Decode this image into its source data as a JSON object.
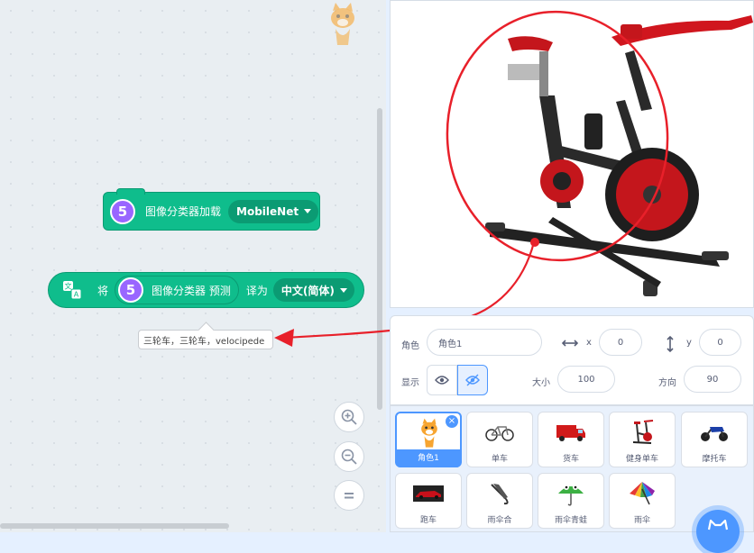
{
  "blocks": {
    "load": {
      "number": "5",
      "label": "图像分类器加载",
      "model": "MobileNet"
    },
    "translate": {
      "label_prefix": "将",
      "number": "5",
      "inner_label": "图像分类器 预测",
      "label_mid": "译为",
      "language": "中文(简体)"
    },
    "result": "三轮车，三轮车，velocipede"
  },
  "sprite_info": {
    "sprite_label": "角色",
    "sprite_name": "角色1",
    "x_label": "x",
    "x_value": "0",
    "y_label": "y",
    "y_value": "0",
    "show_label": "显示",
    "size_label": "大小",
    "size_value": "100",
    "direction_label": "方向",
    "direction_value": "90"
  },
  "sprites": [
    {
      "name": "角色1",
      "icon": "scratch-cat-icon"
    },
    {
      "name": "单车",
      "icon": "bicycle-icon"
    },
    {
      "name": "货车",
      "icon": "truck-icon"
    },
    {
      "name": "健身单车",
      "icon": "exercise-bike-icon"
    },
    {
      "name": "摩托车",
      "icon": "motorcycle-icon"
    },
    {
      "name": "跑车",
      "icon": "sports-car-icon"
    },
    {
      "name": "雨伞合",
      "icon": "closed-umbrella-icon"
    },
    {
      "name": "雨伞青蛙",
      "icon": "frog-umbrella-icon"
    },
    {
      "name": "雨伞",
      "icon": "umbrella-icon"
    }
  ],
  "colors": {
    "extension_green": "#0fbd8c",
    "number_purple": "#9966ff",
    "accent_blue": "#4d97ff",
    "annotation_red": "#e8202a"
  }
}
